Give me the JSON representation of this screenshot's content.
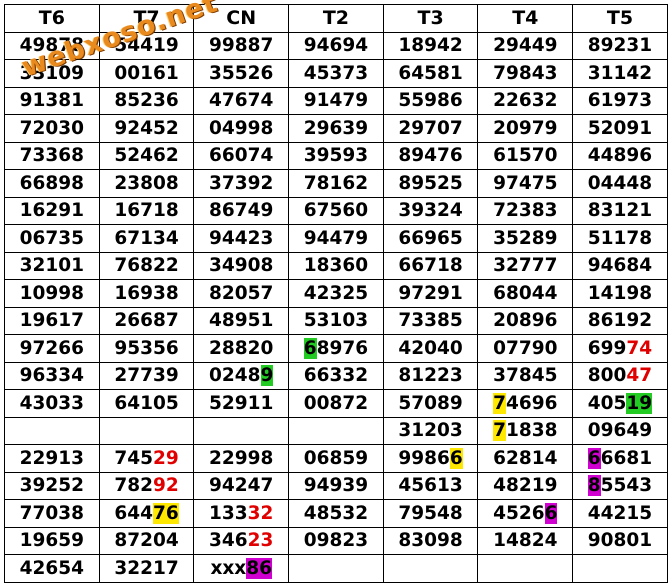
{
  "watermark": "webxoso.net",
  "columns": [
    "T6",
    "T7",
    "CN",
    "T2",
    "T3",
    "T4",
    "T5"
  ],
  "rows": [
    [
      [
        {
          "t": "49878"
        }
      ],
      [
        {
          "t": "54419"
        }
      ],
      [
        {
          "t": "99887"
        }
      ],
      [
        {
          "t": "94694"
        }
      ],
      [
        {
          "t": "18942"
        }
      ],
      [
        {
          "t": "29449"
        }
      ],
      [
        {
          "t": "89231"
        }
      ]
    ],
    [
      [
        {
          "t": "33109"
        }
      ],
      [
        {
          "t": "00161"
        }
      ],
      [
        {
          "t": "35526"
        }
      ],
      [
        {
          "t": "45373"
        }
      ],
      [
        {
          "t": "64581"
        }
      ],
      [
        {
          "t": "79843"
        }
      ],
      [
        {
          "t": "31142"
        }
      ]
    ],
    [
      [
        {
          "t": "91381"
        }
      ],
      [
        {
          "t": "85236"
        }
      ],
      [
        {
          "t": "47674"
        }
      ],
      [
        {
          "t": "91479"
        }
      ],
      [
        {
          "t": "55986"
        }
      ],
      [
        {
          "t": "22632"
        }
      ],
      [
        {
          "t": "61973"
        }
      ]
    ],
    [
      [
        {
          "t": "72030"
        }
      ],
      [
        {
          "t": "92452"
        }
      ],
      [
        {
          "t": "04998"
        }
      ],
      [
        {
          "t": "29639"
        }
      ],
      [
        {
          "t": "29707"
        }
      ],
      [
        {
          "t": "20979"
        }
      ],
      [
        {
          "t": "52091"
        }
      ]
    ],
    [
      [
        {
          "t": "73368"
        }
      ],
      [
        {
          "t": "52462"
        }
      ],
      [
        {
          "t": "66074"
        }
      ],
      [
        {
          "t": "39593"
        }
      ],
      [
        {
          "t": "89476"
        }
      ],
      [
        {
          "t": "61570"
        }
      ],
      [
        {
          "t": "44896"
        }
      ]
    ],
    [
      [
        {
          "t": "66898"
        }
      ],
      [
        {
          "t": "23808"
        }
      ],
      [
        {
          "t": "37392"
        }
      ],
      [
        {
          "t": "78162"
        }
      ],
      [
        {
          "t": "89525"
        }
      ],
      [
        {
          "t": "97475"
        }
      ],
      [
        {
          "t": "04448"
        }
      ]
    ],
    [
      [
        {
          "t": "16291"
        }
      ],
      [
        {
          "t": "16718"
        }
      ],
      [
        {
          "t": "86749"
        }
      ],
      [
        {
          "t": "67560"
        }
      ],
      [
        {
          "t": "39324"
        }
      ],
      [
        {
          "t": "72383"
        }
      ],
      [
        {
          "t": "83121"
        }
      ]
    ],
    [
      [
        {
          "t": "06735"
        }
      ],
      [
        {
          "t": "67134"
        }
      ],
      [
        {
          "t": "94423"
        }
      ],
      [
        {
          "t": "94479"
        }
      ],
      [
        {
          "t": "66965"
        }
      ],
      [
        {
          "t": "35289"
        }
      ],
      [
        {
          "t": "51178"
        }
      ]
    ],
    [
      [
        {
          "t": "32101"
        }
      ],
      [
        {
          "t": "76822"
        }
      ],
      [
        {
          "t": "34908"
        }
      ],
      [
        {
          "t": "18360"
        }
      ],
      [
        {
          "t": "66718"
        }
      ],
      [
        {
          "t": "32777"
        }
      ],
      [
        {
          "t": "94684"
        }
      ]
    ],
    [
      [
        {
          "t": "10998"
        }
      ],
      [
        {
          "t": "16938"
        }
      ],
      [
        {
          "t": "82057"
        }
      ],
      [
        {
          "t": "42325"
        }
      ],
      [
        {
          "t": "97291"
        }
      ],
      [
        {
          "t": "68044"
        }
      ],
      [
        {
          "t": "14198"
        }
      ]
    ],
    [
      [
        {
          "t": "19617"
        }
      ],
      [
        {
          "t": "26687"
        }
      ],
      [
        {
          "t": "48951"
        }
      ],
      [
        {
          "t": "53103"
        }
      ],
      [
        {
          "t": "73385"
        }
      ],
      [
        {
          "t": "20896"
        }
      ],
      [
        {
          "t": "86192"
        }
      ]
    ],
    [
      [
        {
          "t": "97266"
        }
      ],
      [
        {
          "t": "95356"
        }
      ],
      [
        {
          "t": "28820"
        }
      ],
      [
        {
          "t": "6",
          "c": "hl-green"
        },
        {
          "t": "8976"
        }
      ],
      [
        {
          "t": "42040"
        }
      ],
      [
        {
          "t": "07790"
        }
      ],
      [
        {
          "t": "699"
        },
        {
          "t": "74",
          "c": "red"
        }
      ]
    ],
    [
      [
        {
          "t": "96334"
        }
      ],
      [
        {
          "t": "27739"
        }
      ],
      [
        {
          "t": "0248"
        },
        {
          "t": "9",
          "c": "hl-green"
        }
      ],
      [
        {
          "t": "66332"
        }
      ],
      [
        {
          "t": "81223"
        }
      ],
      [
        {
          "t": "37845"
        }
      ],
      [
        {
          "t": "800"
        },
        {
          "t": "47",
          "c": "red"
        }
      ]
    ],
    [
      [
        {
          "t": "43033"
        }
      ],
      [
        {
          "t": "64105"
        }
      ],
      [
        {
          "t": "52911"
        }
      ],
      [
        {
          "t": "00872"
        }
      ],
      [
        {
          "t": "57089"
        }
      ],
      [
        {
          "t": "7",
          "c": "hl-yellow"
        },
        {
          "t": "4696"
        }
      ],
      [
        {
          "t": "405"
        },
        {
          "t": "19",
          "c": "hl-green"
        }
      ]
    ],
    [
      [],
      [],
      [],
      [],
      [
        {
          "t": "31203"
        }
      ],
      [
        {
          "t": "7",
          "c": "hl-yellow"
        },
        {
          "t": "1838"
        }
      ],
      [
        {
          "t": "09649"
        }
      ]
    ],
    [
      [
        {
          "t": "22913"
        }
      ],
      [
        {
          "t": "745"
        },
        {
          "t": "29",
          "c": "red"
        }
      ],
      [
        {
          "t": "22998"
        }
      ],
      [
        {
          "t": "06859"
        }
      ],
      [
        {
          "t": "9986"
        },
        {
          "t": "6",
          "c": "hl-yellow"
        }
      ],
      [
        {
          "t": "62814"
        }
      ],
      [
        {
          "t": "6",
          "c": "hl-magenta"
        },
        {
          "t": "6681"
        }
      ]
    ],
    [
      [
        {
          "t": "39252"
        }
      ],
      [
        {
          "t": "782"
        },
        {
          "t": "92",
          "c": "red"
        }
      ],
      [
        {
          "t": "94247"
        }
      ],
      [
        {
          "t": "94939"
        }
      ],
      [
        {
          "t": "45613"
        }
      ],
      [
        {
          "t": "48219"
        }
      ],
      [
        {
          "t": "8",
          "c": "hl-magenta"
        },
        {
          "t": "5543"
        }
      ]
    ],
    [
      [
        {
          "t": "77038"
        }
      ],
      [
        {
          "t": "644"
        },
        {
          "t": "76",
          "c": "hl-yellow"
        }
      ],
      [
        {
          "t": "133"
        },
        {
          "t": "32",
          "c": "red"
        }
      ],
      [
        {
          "t": "48532"
        }
      ],
      [
        {
          "t": "79548"
        }
      ],
      [
        {
          "t": "4526"
        },
        {
          "t": "6",
          "c": "hl-magenta"
        }
      ],
      [
        {
          "t": "44215"
        }
      ]
    ],
    [
      [
        {
          "t": "19659"
        }
      ],
      [
        {
          "t": "87204"
        }
      ],
      [
        {
          "t": "346"
        },
        {
          "t": "23",
          "c": "red"
        }
      ],
      [
        {
          "t": "09823"
        }
      ],
      [
        {
          "t": "83098"
        }
      ],
      [
        {
          "t": "14824"
        }
      ],
      [
        {
          "t": "90801"
        }
      ]
    ],
    [
      [
        {
          "t": "42654"
        }
      ],
      [
        {
          "t": "32217"
        }
      ],
      [
        {
          "t": "xxx"
        },
        {
          "t": "86",
          "c": "hl-magenta"
        }
      ],
      [],
      [],
      [],
      []
    ]
  ]
}
